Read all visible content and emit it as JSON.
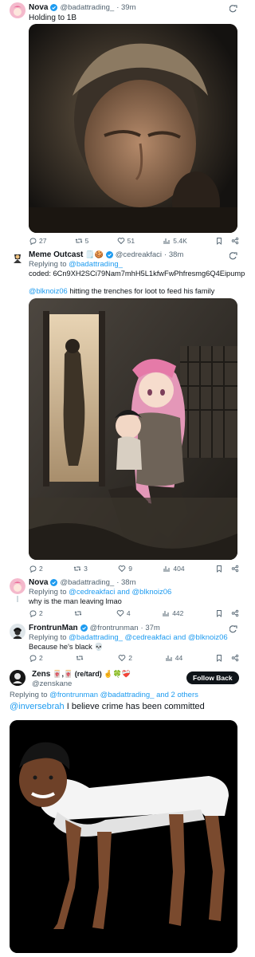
{
  "tweets": [
    {
      "name": "Nova",
      "handle": "@badattrading_",
      "time": "· 39m",
      "text": "Holding to 1B",
      "stats": {
        "replies": "27",
        "retweets": "5",
        "likes": "51",
        "views": "5.4K"
      }
    },
    {
      "name": "Meme Outcast",
      "name_emoji": "🗒️🍪",
      "handle": "@cedreakfaci",
      "time": "· 38m",
      "replying_label": "Replying to",
      "replying_to": "@badattrading_",
      "text_line1": "coded: 6Cn9XH2SCi79Nam7mhH5L1kfwFwPhfresmg6Q4Eipump",
      "mention": "@blknoiz06",
      "text_line2": "hitting the trenches for loot to feed his family",
      "stats": {
        "replies": "2",
        "retweets": "3",
        "likes": "9",
        "views": "404"
      }
    },
    {
      "name": "Nova",
      "handle": "@badattrading_",
      "time": "· 38m",
      "replying_label": "Replying to",
      "replying_to": "@cedreakfaci and @blknoiz06",
      "text": "why is the man leaving lmao",
      "stats": {
        "replies": "2",
        "retweets": "",
        "likes": "4",
        "views": "442"
      }
    },
    {
      "name": "FrontrunMan",
      "handle": "@frontrunman",
      "time": "· 37m",
      "replying_label": "Replying to",
      "replying_to": "@badattrading_ @cedreakfaci and @blknoiz06",
      "text": "Because he's black 💀",
      "stats": {
        "replies": "2",
        "retweets": "",
        "likes": "2",
        "views": "44"
      }
    },
    {
      "name": "Zens",
      "name_emoji": "🀄,🀄 (re/tard) 🤞🍀❤️‍🩹",
      "handle": "@zenskane",
      "follow_label": "Follow Back",
      "replying_label": "Replying to",
      "replying_to": "@frontrunman @badattrading_ and 2 others",
      "mention": "@inversebrah",
      "text": "I believe crime has been committed"
    }
  ],
  "icons": [
    "reply-icon",
    "retweet-icon",
    "like-icon",
    "views-icon",
    "bookmark-icon",
    "share-icon",
    "grok-icon",
    "verified-badge-icon"
  ],
  "colors": {
    "link": "#1d9bf0",
    "muted": "#536471",
    "verified": "#1d9bf0"
  }
}
